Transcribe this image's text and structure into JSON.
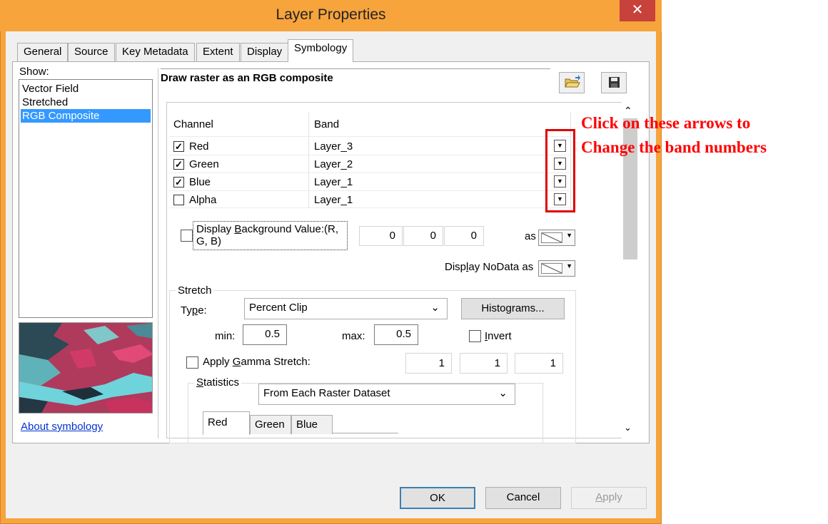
{
  "window": {
    "title": "Layer Properties",
    "close_glyph": "✕",
    "frame_color": "#f7a43c"
  },
  "tabs": [
    {
      "label": "General"
    },
    {
      "label": "Source"
    },
    {
      "label": "Key Metadata"
    },
    {
      "label": "Extent"
    },
    {
      "label": "Display"
    },
    {
      "label": "Symbology",
      "active": true
    }
  ],
  "left_panel": {
    "show_label": "Show:",
    "items": [
      "Vector Field",
      "Stretched",
      "RGB Composite"
    ],
    "selected_index": 2,
    "about_link": "About symbology"
  },
  "main": {
    "heading": "Draw raster as an RGB composite",
    "open_icon": "folder-open-icon",
    "save_icon": "floppy-disk-icon",
    "table": {
      "col_channel": "Channel",
      "col_band": "Band",
      "rows": [
        {
          "channel": "Red",
          "band": "Layer_3",
          "checked": true
        },
        {
          "channel": "Green",
          "band": "Layer_2",
          "checked": true
        },
        {
          "channel": "Blue",
          "band": "Layer_1",
          "checked": true
        },
        {
          "channel": "Alpha",
          "band": "Layer_1",
          "checked": false
        }
      ]
    },
    "background": {
      "label_line1": "Display Background Value:(R,",
      "label_line2": "G, B)",
      "r": "0",
      "g": "0",
      "b": "0",
      "as_label": "as",
      "nodata_label": "Display NoData as"
    },
    "stretch": {
      "legend": "Stretch",
      "type_label": "Type:",
      "type_value": "Percent Clip",
      "histograms_button": "Histograms...",
      "min_label": "min:",
      "min_value": "0.5",
      "max_label": "max:",
      "max_value": "0.5",
      "invert_label": "Invert",
      "gamma_label": "Apply Gamma Stretch:",
      "gamma_values": [
        "1",
        "1",
        "1"
      ],
      "statistics_legend": "Statistics",
      "statistics_value": "From Each Raster Dataset",
      "stat_tabs": [
        "Red",
        "Green",
        "Blue"
      ]
    }
  },
  "annotation": {
    "line1": "Click on these arrows to",
    "line2": "Change the band numbers",
    "color": "#ff0000"
  },
  "buttons": {
    "ok": "OK",
    "cancel": "Cancel",
    "apply": "Apply"
  }
}
